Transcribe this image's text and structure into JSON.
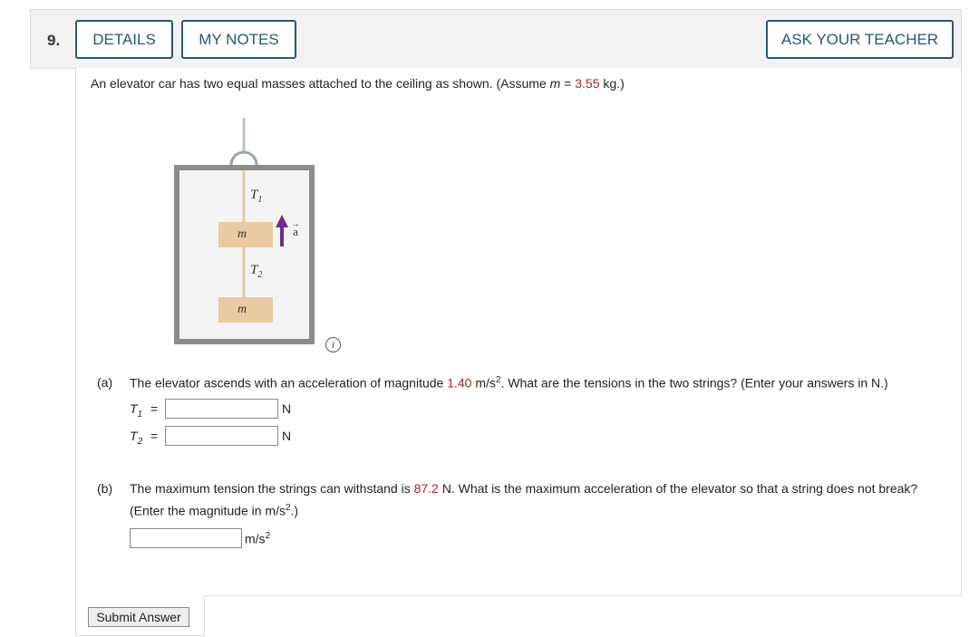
{
  "header": {
    "question_number": "9.",
    "details_label": "DETAILS",
    "notes_label": "MY NOTES",
    "ask_label": "ASK YOUR TEACHER"
  },
  "problem": {
    "intro_before": "An elevator car has two equal masses attached to the ceiling as shown. (Assume ",
    "intro_var": "m",
    "intro_eq": " = ",
    "mass_value": "3.55",
    "intro_after": " kg.)"
  },
  "figure": {
    "t1_label": "T",
    "t1_sub": "1",
    "t2_label": "T",
    "t2_sub": "2",
    "mass_top": "m",
    "mass_bottom": "m",
    "accel_label": "a",
    "accel_arrow": "→",
    "info_glyph": "i"
  },
  "part_a": {
    "label": "(a)",
    "text_before": "The elevator ascends with an acceleration of magnitude ",
    "accel_value": "1.40",
    "unit_base": " m/s",
    "unit_exp": "2",
    "text_after": ". What are the tensions in the two strings? (Enter your answers in N.)",
    "t1_var": "T",
    "t1_sub": "1",
    "t2_var": "T",
    "t2_sub": "2",
    "eq": "=",
    "t1_value": "",
    "t2_value": "",
    "t1_unit": "N",
    "t2_unit": "N"
  },
  "part_b": {
    "label": "(b)",
    "text_before": "The maximum tension the strings can withstand is ",
    "tension_value": "87.2",
    "text_after": " N. What is the maximum acceleration of the elevator so that a string does not break?",
    "line2_before": "(Enter the magnitude in m/s",
    "line2_exp": "2",
    "line2_after": ".)",
    "answer_value": "",
    "unit_base": "m/s",
    "unit_exp": "2"
  },
  "submit_label": "Submit Answer"
}
